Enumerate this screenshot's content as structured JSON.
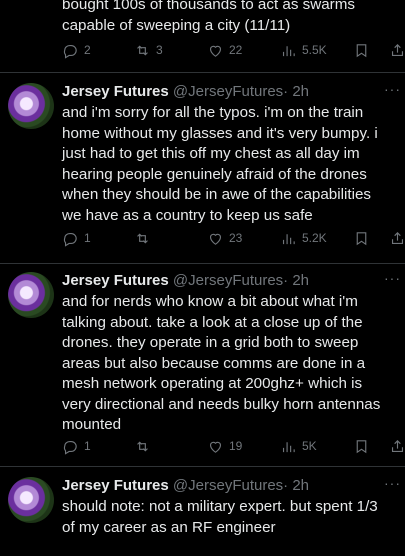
{
  "tweets": [
    {
      "body": "bought 100s of thousands to act as swarms\ncapable of sweeping a city (11/11)",
      "replies": "2",
      "retweets": "3",
      "likes": "22",
      "views": "5.5K"
    },
    {
      "name": "Jersey Futures",
      "handle": "@JerseyFutures",
      "time": "· 2h",
      "body": "and i'm sorry for all the typos. i'm on the train\nhome without my glasses and it's very bumpy. i\njust had to get this off my chest as all day im\nhearing people genuinely afraid of the drones\nwhen they should be in awe of the capabilities\nwe have as a country to keep us safe",
      "replies": "1",
      "retweets": "",
      "likes": "23",
      "views": "5.2K"
    },
    {
      "name": "Jersey Futures",
      "handle": "@JerseyFutures",
      "time": "· 2h",
      "body": "and for nerds who know a bit about what i'm\ntalking about. take a look at a close up of the\ndrones. they operate in a grid both to sweep\nareas but also because comms are done in a\nmesh network operating at 200ghz+ which is\nvery directional and needs bulky horn antennas\nmounted",
      "replies": "1",
      "retweets": "",
      "likes": "19",
      "views": "5K"
    },
    {
      "name": "Jersey Futures",
      "handle": "@JerseyFutures",
      "time": "· 2h",
      "body": "should note: not a military expert. but spent 1/3\nof my career as an RF engineer"
    }
  ],
  "more_glyph": "···"
}
